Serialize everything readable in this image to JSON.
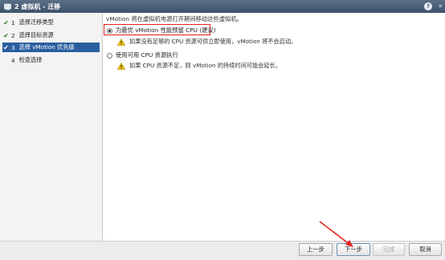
{
  "window": {
    "title": "2 虚拟机 - 迁移",
    "help_label": "?",
    "expand_label": "»"
  },
  "steps": [
    {
      "num": "1",
      "label": "选择迁移类型",
      "done": true
    },
    {
      "num": "2",
      "label": "选择目标资源",
      "done": true
    },
    {
      "num": "3",
      "label": "选择 vMotion 优先级",
      "done": true,
      "active": true
    },
    {
      "num": "4",
      "label": "检查选择",
      "done": false
    }
  ],
  "content": {
    "description": "vMotion 将在虚拟机电源打开期间移动这些虚拟机。",
    "options": [
      {
        "label": "为最优 vMotion 性能预留 CPU (建议)",
        "selected": true,
        "warning": "如果没有足够的 CPU 资源可供立即使用，vMotion 将不会启动。"
      },
      {
        "label": "使用可用 CPU 资源执行",
        "selected": false,
        "warning": "如果 CPU 资源不足，则 vMotion 的持续时间可能会延长。"
      }
    ]
  },
  "footer": {
    "back": "上一步",
    "next": "下一步",
    "finish": "完成",
    "cancel": "取消"
  },
  "colors": {
    "titlebar": "#4a5d75",
    "active_step": "#2a5fa0",
    "highlight_box": "#e32020",
    "annotation_arrow": "#e32020",
    "warning_icon": "#f2c200"
  }
}
